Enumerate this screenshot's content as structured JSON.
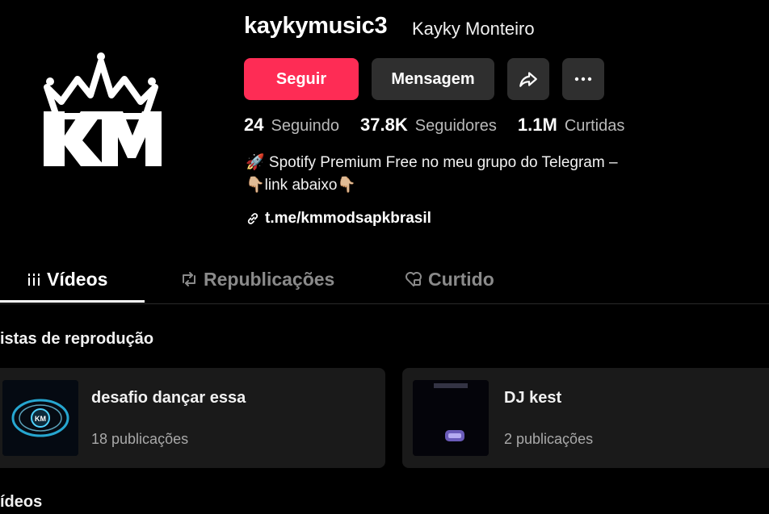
{
  "profile": {
    "username": "kaykymusic3",
    "display_name": "Kayky Monteiro",
    "avatar_icon": "crown-km-logo"
  },
  "actions": {
    "follow_label": "Seguir",
    "message_label": "Mensagem",
    "share_icon": "share-arrow-icon",
    "more_icon": "more-dots-icon"
  },
  "stats": [
    {
      "value": "24",
      "label": "Seguindo"
    },
    {
      "value": "37.8K",
      "label": "Seguidores"
    },
    {
      "value": "1.1M",
      "label": "Curtidas"
    }
  ],
  "bio": {
    "line1": "🚀 Spotify Premium Free no meu grupo do Telegram –",
    "line2": "👇🏼link abaixo👇🏼",
    "link": "t.me/kmmodsapkbrasil"
  },
  "tabs": [
    {
      "label": "Vídeos",
      "active": true
    },
    {
      "label": "Republicações",
      "active": false
    },
    {
      "label": "Curtido",
      "active": false
    }
  ],
  "sections": {
    "playlists_title": "istas de reprodução",
    "videos_title": "ídeos"
  },
  "playlists": [
    {
      "title": "desafio dançar essa",
      "count": "18 publicações"
    },
    {
      "title": "DJ kest",
      "count": "2 publicações"
    }
  ],
  "colors": {
    "accent": "#fe2c55",
    "background": "#000000",
    "button_dark": "#2f2f2f",
    "card_bg": "#1a1a1a"
  }
}
